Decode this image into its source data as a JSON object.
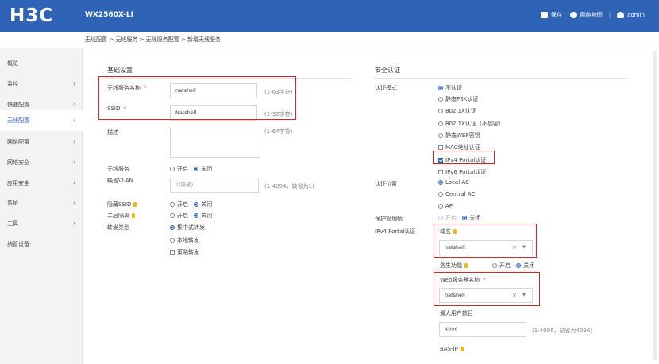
{
  "header": {
    "logo": "H3C",
    "model": "WX2560X-LI",
    "save": "保存",
    "net_map": "网络地图",
    "divider": "|",
    "user": "admin",
    "colors": {
      "bar": "#2e63b5",
      "highlight": "#e02020"
    }
  },
  "breadcrumb": "无线配置 > 无线服务 > 无线服务配置 > 新增无线服务",
  "sidebar": {
    "items": [
      {
        "label": "概览",
        "arrow": ""
      },
      {
        "label": "监控",
        "arrow": "›"
      },
      {
        "label": "快速配置",
        "arrow": "›"
      },
      {
        "label": "无线配置",
        "arrow": "›"
      },
      {
        "label": "网络配置",
        "arrow": "›"
      },
      {
        "label": "网络安全",
        "arrow": "›"
      },
      {
        "label": "应用安全",
        "arrow": "›"
      },
      {
        "label": "系统",
        "arrow": "›"
      },
      {
        "label": "工具",
        "arrow": "›"
      },
      {
        "label": "纳管设备",
        "arrow": ""
      }
    ]
  },
  "basic": {
    "title": "基础设置",
    "ssid_name": {
      "label": "无线服务名称",
      "required": "*",
      "value": "natshell",
      "hint": "(1-63字符)"
    },
    "ssid": {
      "label": "SSID",
      "required": "*",
      "value": "Natshell",
      "hint": "(1-32字符)"
    },
    "desc": {
      "label": "描述",
      "hint": "(1-64字符)"
    },
    "service": {
      "label": "无线服务",
      "on": "开启",
      "off": "关闭"
    },
    "vlan": {
      "label": "缺省VLAN",
      "placeholder": "1(缺省)",
      "hint": "(1-4094，缺省为1)"
    },
    "hide_ssid": {
      "label": "隐藏SSID",
      "on": "开启",
      "off": "关闭"
    },
    "l2_isolation": {
      "label": "二层隔离",
      "on": "开启",
      "off": "关闭"
    },
    "forward": {
      "label": "转发类型",
      "central": "集中式转发",
      "local": "本地转发",
      "policy": "策略转发"
    }
  },
  "security": {
    "title": "安全认证",
    "auth_mode": {
      "label": "认证模式",
      "no_auth": "不认证",
      "static_psk": "静态PSK认证",
      "dot1x": "802.1X认证",
      "dot1x_noenc": "802.1X认证（不加密）",
      "static_wep": "静态WEP密钥",
      "mac_auth": "MAC地址认证",
      "ipv4_portal": "IPv4 Portal认证",
      "ipv6_portal": "IPv6 Portal认证"
    },
    "auth_location": {
      "label": "认证位置",
      "local": "Local AC",
      "central": "Central AC",
      "ap": "AP"
    },
    "mgmt_frame": {
      "label": "保护管理帧",
      "on": "开启",
      "off": "关闭"
    },
    "portal": {
      "label": "IPv4 Portal认证",
      "domain_label": "域名",
      "domain_value": "natshell",
      "escape_label": "逃生功能",
      "escape_on": "开启",
      "escape_off": "关闭",
      "web_server_label": "Web服务器名称",
      "web_server_required": "*",
      "web_server_value": "natshell",
      "max_users_label": "最大用户数目",
      "max_users_value": "4096",
      "max_users_hint": "(1-4096，缺省为4096)",
      "bas_ip_label": "BAS-IP",
      "clear": "×",
      "dropdown": "▼"
    }
  }
}
